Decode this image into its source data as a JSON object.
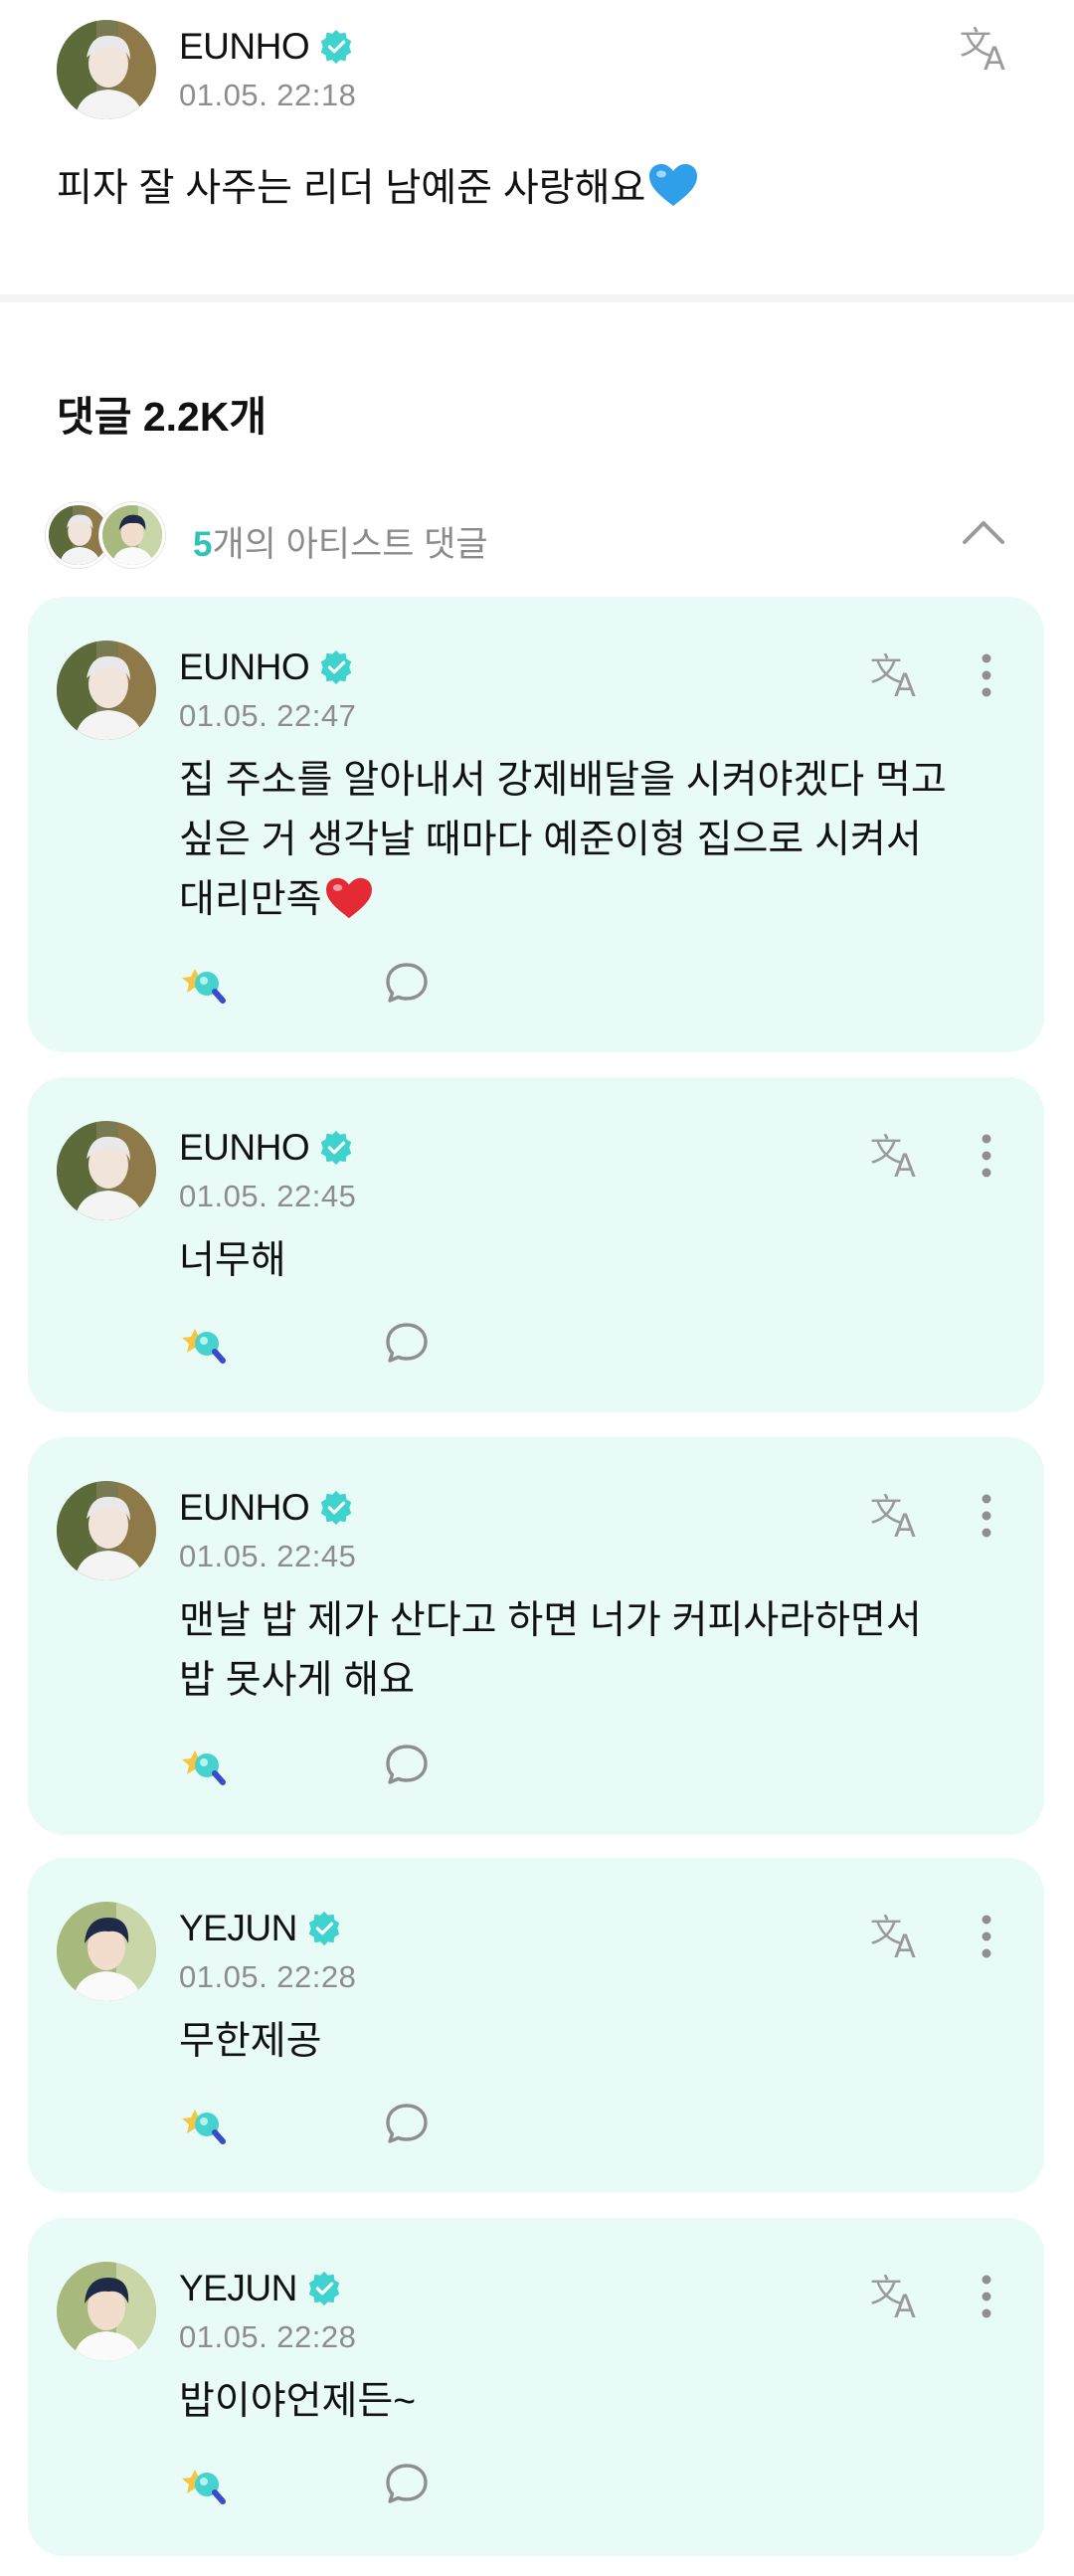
{
  "post": {
    "author": "EUNHO",
    "time": "01.05. 22:18",
    "text": "피자 잘 사주는 리더 남예준 사랑해요"
  },
  "comments_section": {
    "title": "댓글 2.2K개",
    "artist_count": "5",
    "artist_label": "개의 아티스트 댓글"
  },
  "comments": [
    {
      "author": "EUNHO",
      "time": "01.05. 22:47",
      "lines": [
        "집 주소를 알아내서 강제배달을 시켜야겠다 먹고",
        "싶은 거 생각날 때마다 예준이형 집으로 시켜서",
        "대리만족"
      ]
    },
    {
      "author": "EUNHO",
      "time": "01.05. 22:45",
      "lines": [
        "너무해"
      ]
    },
    {
      "author": "EUNHO",
      "time": "01.05. 22:45",
      "lines": [
        "맨날 밥 제가 산다고 하면 너가 커피사라하면서",
        "밥 못사게 해요"
      ]
    },
    {
      "author": "YEJUN",
      "time": "01.05. 22:28",
      "lines": [
        "무한제공"
      ]
    },
    {
      "author": "YEJUN",
      "time": "01.05. 22:28",
      "lines": [
        "밥이야언제든~"
      ]
    }
  ],
  "colors": {
    "accent": "#2fc4b4",
    "verified": "#3ed3cf",
    "card_bg": "#e8fbf6",
    "secondary_text": "#8d8d8d"
  },
  "icons": {
    "verified": "verified-badge-icon",
    "translate": "translate-icon",
    "more": "more-vertical-icon",
    "react": "cheer-light-stick-icon",
    "reply": "speech-bubble-icon",
    "collapse": "chevron-up-icon",
    "heart_blue": "blue-heart-emoji",
    "heart_red": "red-heart-emoji"
  }
}
